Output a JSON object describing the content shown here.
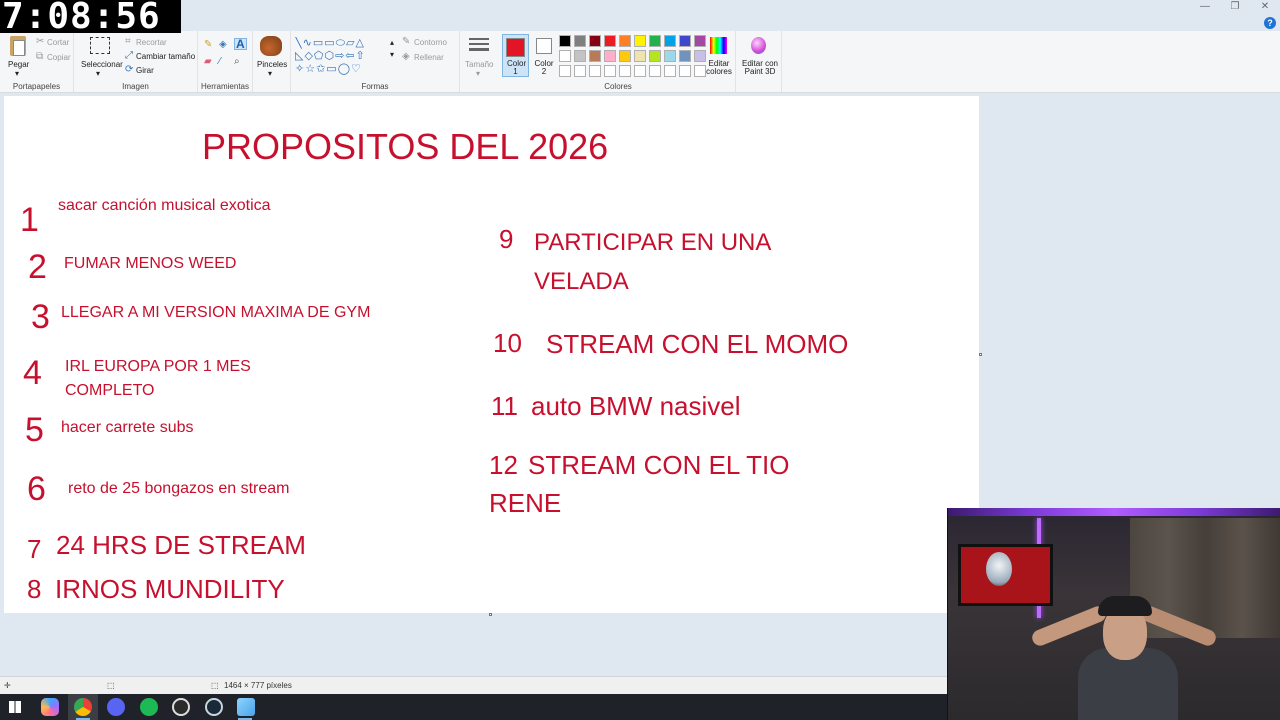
{
  "timer": "7:08:56",
  "window_controls": {
    "minimize": "—",
    "restore": "❐",
    "close": "✕",
    "help": "?"
  },
  "ribbon": {
    "clipboard": {
      "paste": "Pegar",
      "cut": "Cortar",
      "copy": "Copiar",
      "group": "Portapapeles"
    },
    "image": {
      "select": "Seleccionar",
      "crop": "Recortar",
      "resize": "Cambiar tamaño",
      "rotate": "Girar",
      "group": "Imagen"
    },
    "tools": {
      "group": "Herramientas"
    },
    "brushes": {
      "label": "Pinceles"
    },
    "shapes": {
      "outline": "Contorno",
      "fill": "Rellenar",
      "group": "Formas"
    },
    "size": {
      "label": "Tamaño"
    },
    "colors": {
      "color1": "Color 1",
      "color2": "Color 2",
      "edit": "Editar colores",
      "paint3d": "Editar con Paint 3D",
      "group": "Colores"
    }
  },
  "palette": [
    "#000000",
    "#7f7f7f",
    "#880015",
    "#ed1c24",
    "#ff7f27",
    "#fff200",
    "#22b14c",
    "#00a2e8",
    "#3f48cc",
    "#a349a4",
    "#ffffff",
    "#c3c3c3",
    "#b97a57",
    "#ffaec9",
    "#ffc90e",
    "#efe4b0",
    "#b5e61d",
    "#99d9ea",
    "#7092be",
    "#c8bfe7",
    "#ffffff",
    "#ffffff",
    "#ffffff",
    "#ffffff",
    "#ffffff",
    "#ffffff",
    "#ffffff",
    "#ffffff",
    "#ffffff",
    "#ffffff"
  ],
  "colors_state": {
    "color1": "#e11525",
    "color2": "#ffffff",
    "ink": "#c6102e"
  },
  "canvas": {
    "title": "PROPOSITOS DEL 2026",
    "items": [
      {
        "num": "1",
        "text": "sacar canción musical exotica"
      },
      {
        "num": "2",
        "text": "FUMAR MENOS WEED"
      },
      {
        "num": "3",
        "text": "LLEGAR A MI VERSION MAXIMA DE GYM"
      },
      {
        "num": "4",
        "text": "IRL EUROPA POR 1 MES",
        "text2": "COMPLETO"
      },
      {
        "num": "5",
        "text": "hacer carrete subs"
      },
      {
        "num": "6",
        "text": "reto de 25 bongazos en stream"
      },
      {
        "num": "7",
        "text": "24 HRS DE STREAM"
      },
      {
        "num": "8",
        "text": "IRNOS MUNDILITY"
      },
      {
        "num": "9",
        "text": "PARTICIPAR EN UNA",
        "text2": "VELADA"
      },
      {
        "num": "10",
        "text": "STREAM CON EL MOMO"
      },
      {
        "num": "11",
        "text": "auto BMW nasivel"
      },
      {
        "num": "12",
        "text": "STREAM CON EL TIO",
        "text2": "RENE"
      }
    ]
  },
  "statusbar": {
    "dimensions": "1464 × 777 píxeles"
  },
  "taskbar": {
    "apps": [
      "windows-start-icon",
      "copilot-icon",
      "chrome-icon",
      "discord-icon",
      "spotify-icon",
      "obs-icon",
      "steam-icon",
      "paint-icon"
    ]
  }
}
